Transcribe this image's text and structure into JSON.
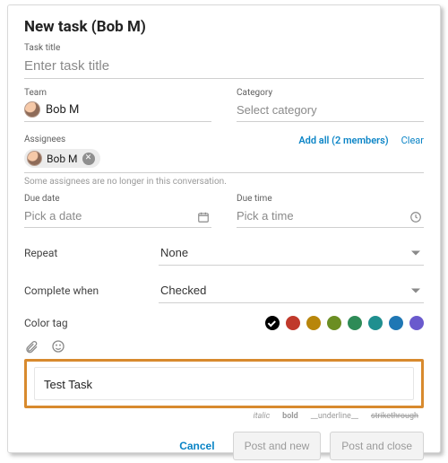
{
  "header": {
    "title": "New task (Bob M)"
  },
  "task_title": {
    "label": "Task title",
    "placeholder": "Enter task title",
    "value": ""
  },
  "team": {
    "label": "Team",
    "value": "Bob M"
  },
  "category": {
    "label": "Category",
    "placeholder": "Select category",
    "value": ""
  },
  "assignees": {
    "label": "Assignees",
    "add_all": "Add all (2 members)",
    "clear": "Clear",
    "chip_name": "Bob M",
    "hint": "Some assignees are no longer in this conversation."
  },
  "due_date": {
    "label": "Due date",
    "placeholder": "Pick a date",
    "value": ""
  },
  "due_time": {
    "label": "Due time",
    "placeholder": "Pick a time",
    "value": ""
  },
  "repeat": {
    "label": "Repeat",
    "value": "None"
  },
  "complete_when": {
    "label": "Complete when",
    "value": "Checked"
  },
  "color_tag": {
    "label": "Color tag",
    "swatches": [
      "#000000",
      "#c0392b",
      "#b8860b",
      "#6b8e23",
      "#2e8b57",
      "#1f8f8f",
      "#1f77b4",
      "#6a5acd"
    ],
    "selected_index": 0
  },
  "description": {
    "value": "Test Task"
  },
  "format_hints": {
    "italic": "italic",
    "bold": "bold",
    "underline": "__underline__",
    "strike": "strikethrough"
  },
  "footer": {
    "cancel": "Cancel",
    "post_new": "Post and new",
    "post_close": "Post and close"
  }
}
